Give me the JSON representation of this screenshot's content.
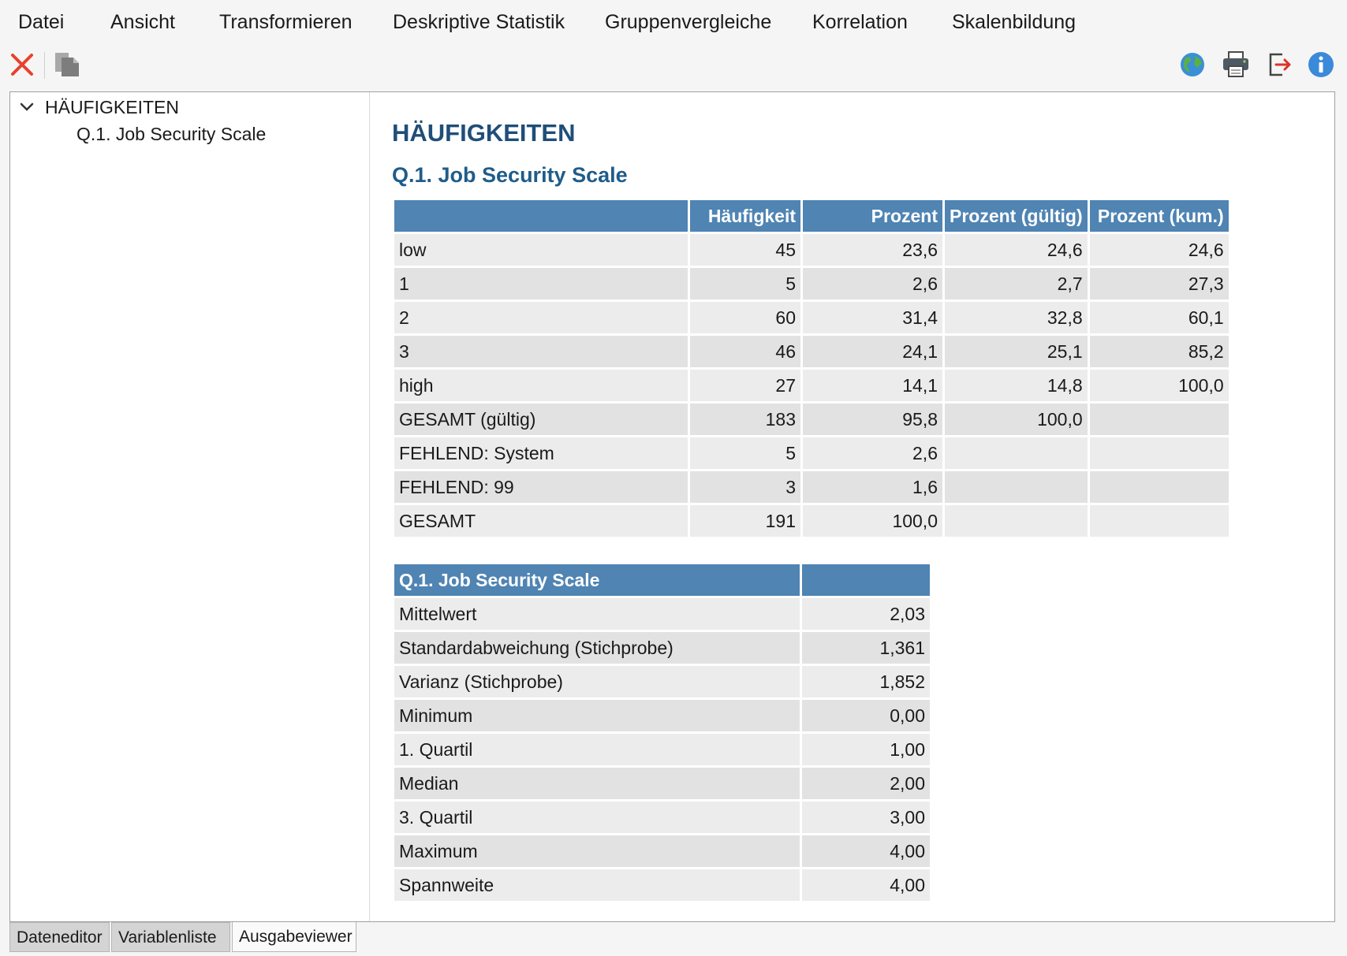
{
  "menu": [
    "Datei",
    "Ansicht",
    "Transformieren",
    "Deskriptive Statistik",
    "Gruppenvergleiche",
    "Korrelation",
    "Skalenbildung"
  ],
  "toolbar": {
    "left_icons": [
      "close-icon",
      "copy-icon"
    ],
    "right_icons": [
      "globe-icon",
      "printer-icon",
      "export-icon",
      "info-icon"
    ],
    "colors": {
      "close": "#e8412c",
      "info": "#3b8ad9",
      "export_arrow": "#d9342b"
    }
  },
  "tree": {
    "root": "HÄUFIGKEITEN",
    "children": [
      "Q.1. Job Security Scale"
    ]
  },
  "output": {
    "heading": "HÄUFIGKEITEN",
    "subheading": "Q.1. Job Security Scale",
    "freq_table": {
      "headers": [
        "",
        "Häufigkeit",
        "Prozent",
        "Prozent (gültig)",
        "Prozent (kum.)"
      ],
      "rows": [
        [
          "low",
          "45",
          "23,6",
          "24,6",
          "24,6"
        ],
        [
          "1",
          "5",
          "2,6",
          "2,7",
          "27,3"
        ],
        [
          "2",
          "60",
          "31,4",
          "32,8",
          "60,1"
        ],
        [
          "3",
          "46",
          "24,1",
          "25,1",
          "85,2"
        ],
        [
          "high",
          "27",
          "14,1",
          "14,8",
          "100,0"
        ],
        [
          "GESAMT (gültig)",
          "183",
          "95,8",
          "100,0",
          ""
        ],
        [
          "FEHLEND: System",
          "5",
          "2,6",
          "",
          ""
        ],
        [
          "FEHLEND: 99",
          "3",
          "1,6",
          "",
          ""
        ],
        [
          "GESAMT",
          "191",
          "100,0",
          "",
          ""
        ]
      ]
    },
    "stats_table": {
      "headers": [
        "Q.1. Job Security Scale",
        ""
      ],
      "rows": [
        [
          "Mittelwert",
          "2,03"
        ],
        [
          "Standardabweichung (Stichprobe)",
          "1,361"
        ],
        [
          "Varianz (Stichprobe)",
          "1,852"
        ],
        [
          "Minimum",
          "0,00"
        ],
        [
          "1. Quartil",
          "1,00"
        ],
        [
          "Median",
          "2,00"
        ],
        [
          "3. Quartil",
          "3,00"
        ],
        [
          "Maximum",
          "4,00"
        ],
        [
          "Spannweite",
          "4,00"
        ]
      ]
    }
  },
  "tabs": [
    "Dateneditor",
    "Variablenliste",
    "Ausgabeviewer"
  ],
  "active_tab": "Ausgabeviewer"
}
